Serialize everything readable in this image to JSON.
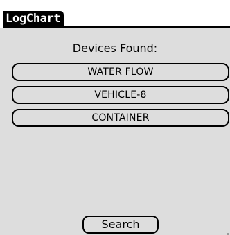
{
  "app": {
    "title": "LogChart"
  },
  "main": {
    "heading": "Devices Found:",
    "devices": [
      {
        "label": "WATER FLOW"
      },
      {
        "label": "VEHICLE-8"
      },
      {
        "label": "CONTAINER"
      }
    ],
    "search_label": "Search"
  },
  "colors": {
    "title_background": "#000000",
    "title_text": "#ffffff",
    "form_background": "#dddddd",
    "button_border": "#000000"
  }
}
